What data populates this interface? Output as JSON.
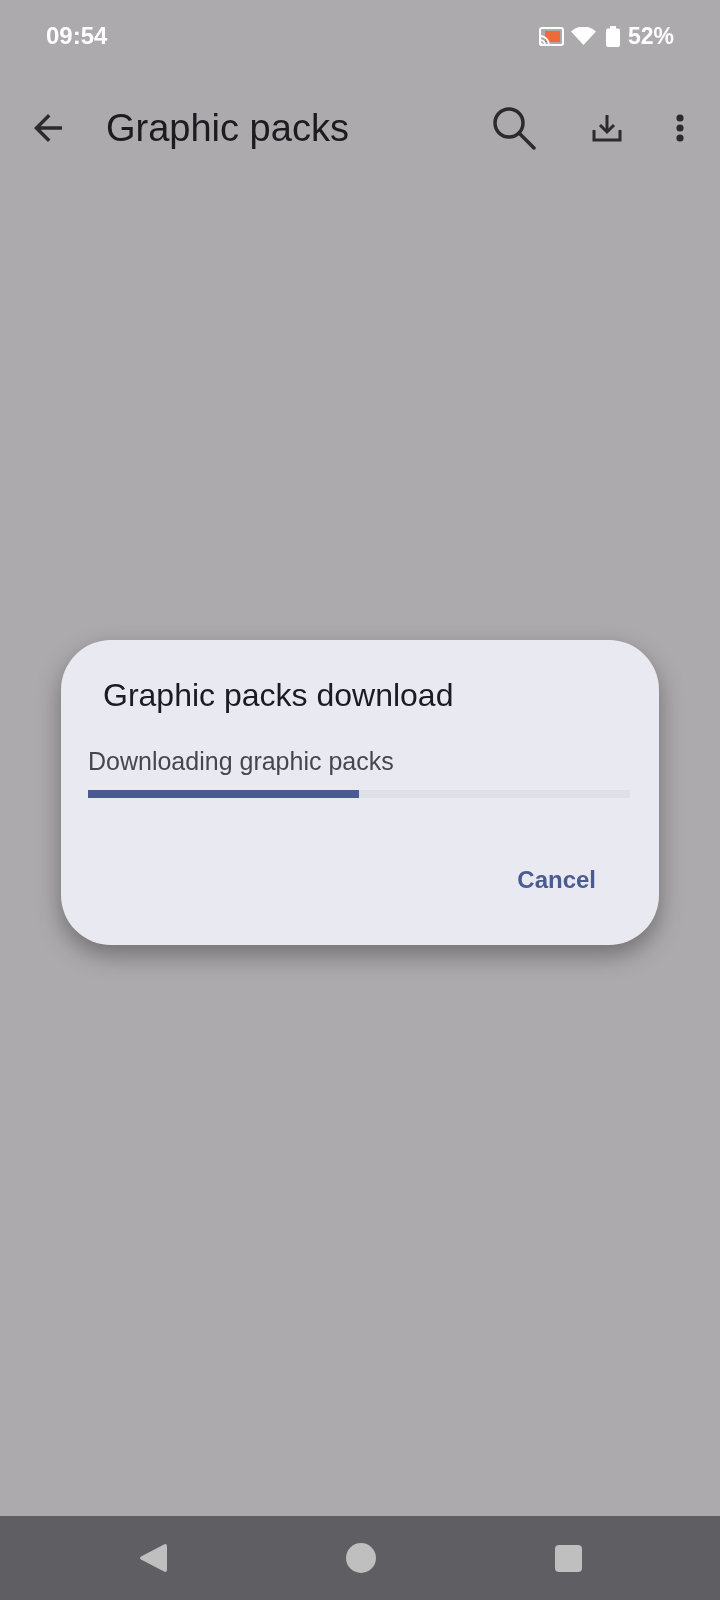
{
  "status_bar": {
    "time": "09:54",
    "battery": "52%"
  },
  "toolbar": {
    "title": "Graphic packs"
  },
  "dialog": {
    "title": "Graphic packs download",
    "message": "Downloading graphic packs",
    "progress": {
      "level": 0.5
    },
    "buttons": [
      "Cancel"
    ]
  }
}
